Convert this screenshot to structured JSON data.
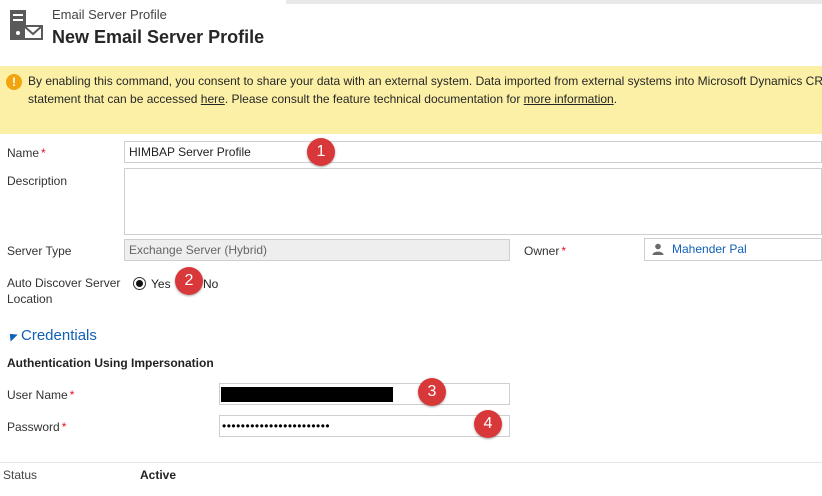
{
  "header": {
    "entity_name": "Email Server Profile",
    "record_title": "New Email Server Profile",
    "icon": "email-server-profile-icon"
  },
  "notice": {
    "icon": "warning-icon",
    "line1": "By enabling this command, you consent to share your data with an external system. Data imported from external systems into Microsoft Dynamics CR",
    "line2_before": "statement that can be accessed ",
    "line2_link1": "here",
    "line2_middle": ". Please consult the feature technical documentation for ",
    "line2_link2": "more information",
    "line2_after": "."
  },
  "form": {
    "name": {
      "label": "Name",
      "required": "*",
      "value": "HIMBAP Server Profile"
    },
    "description": {
      "label": "Description",
      "value": ""
    },
    "server_type": {
      "label": "Server Type",
      "value": "Exchange Server (Hybrid)"
    },
    "owner": {
      "label": "Owner",
      "required": "*",
      "value": "Mahender Pal",
      "icon": "user-icon"
    },
    "auto_discover": {
      "label_line1": "Auto Discover Server",
      "label_line2": "Location",
      "option_yes": "Yes",
      "option_no": "No",
      "selected": "Yes"
    }
  },
  "credentials": {
    "section_title": "Credentials",
    "subsection_title": "Authentication Using Impersonation",
    "user_name": {
      "label": "User Name",
      "required": "*"
    },
    "password": {
      "label": "Password",
      "required": "*",
      "value": "•••••••••••••••••••••••"
    }
  },
  "badges": [
    "1",
    "2",
    "3",
    "4"
  ],
  "footer": {
    "status_label": "Status",
    "status_value": "Active"
  },
  "colors": {
    "accent_blue": "#1160b7",
    "notice_bg": "#fcf0a6",
    "badge_red": "#d9383a",
    "required_red": "#e81123"
  }
}
